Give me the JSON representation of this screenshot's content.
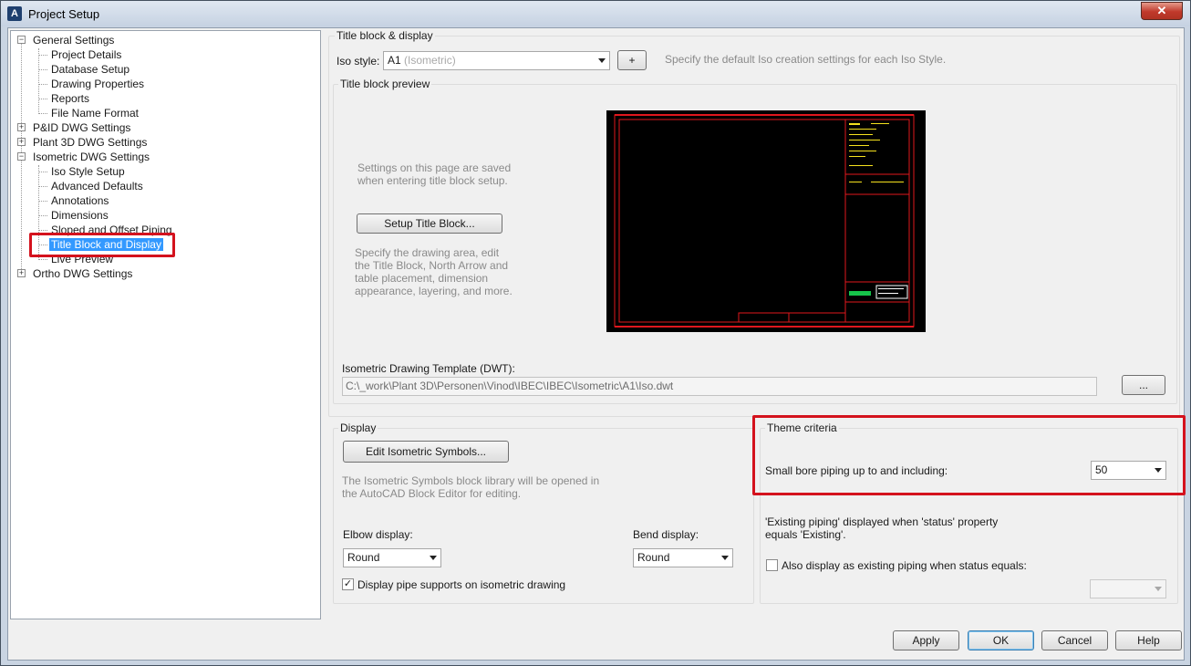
{
  "window": {
    "title": "Project Setup",
    "close_glyph": "✕",
    "app_icon": "A"
  },
  "tree": {
    "items": [
      {
        "label": "General Settings",
        "expander": "−"
      },
      {
        "label": "Project Details"
      },
      {
        "label": "Database Setup"
      },
      {
        "label": "Drawing Properties"
      },
      {
        "label": "Reports"
      },
      {
        "label": "File Name Format"
      },
      {
        "label": "P&ID DWG Settings",
        "expander": "+"
      },
      {
        "label": "Plant 3D DWG Settings",
        "expander": "+"
      },
      {
        "label": "Isometric DWG Settings",
        "expander": "−"
      },
      {
        "label": "Iso Style Setup"
      },
      {
        "label": "Advanced Defaults"
      },
      {
        "label": "Annotations"
      },
      {
        "label": "Dimensions"
      },
      {
        "label": "Sloped and Offset Piping"
      },
      {
        "label": "Title Block and Display",
        "selected": true
      },
      {
        "label": "Live Preview"
      },
      {
        "label": "Ortho DWG Settings",
        "expander": "+"
      }
    ]
  },
  "title_block": {
    "group_label": "Title block & display",
    "iso_style_label": "Iso style:",
    "iso_style_value": "A1",
    "iso_style_suffix": "(Isometric)",
    "add_button": "+",
    "iso_style_hint": "Specify the default Iso creation settings for each Iso Style.",
    "preview_group_label": "Title block preview",
    "saved_note": "Settings on this page are saved when entering title block setup.",
    "setup_button": "Setup Title Block...",
    "setup_hint": "Specify the drawing area, edit the Title Block, North Arrow and table placement, dimension appearance, layering, and more.",
    "template_label": "Isometric Drawing Template (DWT):",
    "template_path": "C:\\_work\\Plant 3D\\Personen\\Vinod\\IBEC\\IBEC\\Isometric\\A1\\Iso.dwt",
    "browse_button": "..."
  },
  "display": {
    "group_label": "Display",
    "edit_symbols_button": "Edit Isometric Symbols...",
    "symbols_hint": "The Isometric Symbols block library will be opened in the AutoCAD Block Editor for editing.",
    "elbow_label": "Elbow display:",
    "elbow_value": "Round",
    "bend_label": "Bend display:",
    "bend_value": "Round",
    "supports_label": "Display pipe supports on isometric drawing",
    "supports_checked": "✓"
  },
  "theme": {
    "group_label": "Theme criteria",
    "small_bore_label": "Small bore piping up to and including:",
    "small_bore_value": "50",
    "existing_note": "'Existing piping' displayed when 'status' property equals 'Existing'.",
    "also_display_label": "Also display as existing piping when status equals:",
    "also_display_value": ""
  },
  "footer": {
    "apply": "Apply",
    "ok": "OK",
    "cancel": "Cancel",
    "help": "Help"
  },
  "colors": {
    "highlight": "#d4121d",
    "selection": "#3399ff",
    "preview_lines": "#e0171d",
    "preview_text": "#f5e11e",
    "preview_green": "#16c44a"
  }
}
